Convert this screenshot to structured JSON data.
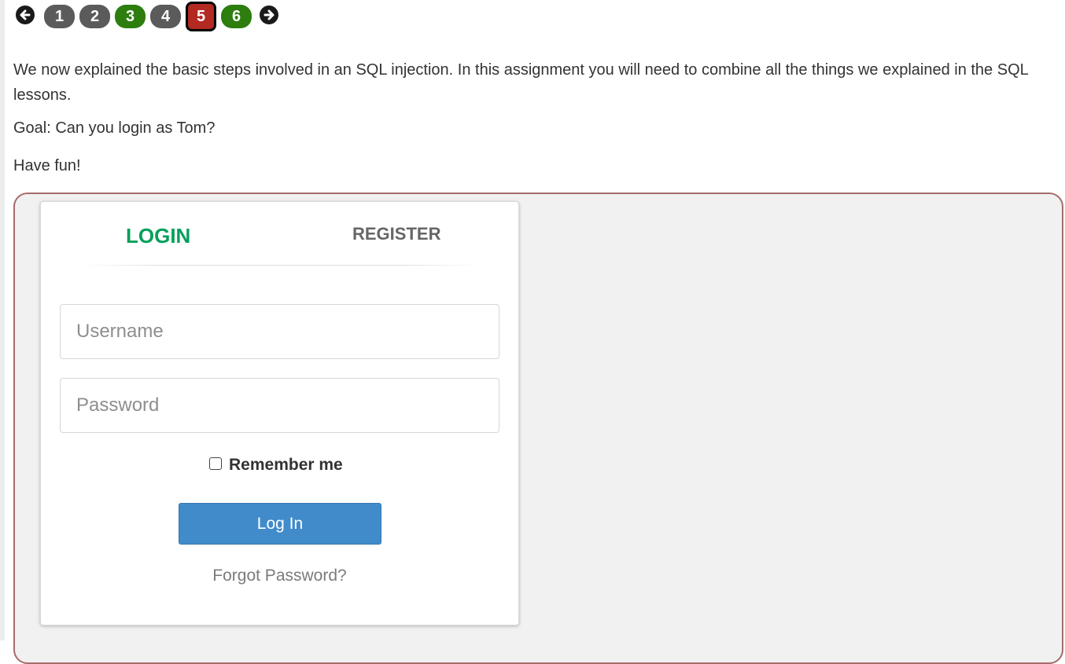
{
  "pagination": {
    "pages": [
      {
        "label": "1",
        "state": "gray"
      },
      {
        "label": "2",
        "state": "gray"
      },
      {
        "label": "3",
        "state": "green"
      },
      {
        "label": "4",
        "state": "gray"
      },
      {
        "label": "5",
        "state": "current"
      },
      {
        "label": "6",
        "state": "green"
      }
    ],
    "prev_icon": "arrow-left-circle-icon",
    "next_icon": "arrow-right-circle-icon"
  },
  "lesson": {
    "intro": "We now explained the basic steps involved in an SQL injection. In this assignment you will need to combine all the things we explained in the SQL lessons.",
    "goal": "Goal: Can you login as Tom?",
    "outro": "Have fun!"
  },
  "form": {
    "tabs": {
      "login": "LOGIN",
      "register": "REGISTER"
    },
    "username_placeholder": "Username",
    "password_placeholder": "Password",
    "remember_label": "Remember me",
    "submit_label": "Log In",
    "forgot_label": "Forgot Password?"
  },
  "colors": {
    "active_tab": "#029f5b",
    "current_page": "#b22a22",
    "solved_page": "#2d7d0f",
    "unsolved_page": "#5b5b5b",
    "submit_button": "#418bca",
    "container_border": "#a86b6b"
  }
}
